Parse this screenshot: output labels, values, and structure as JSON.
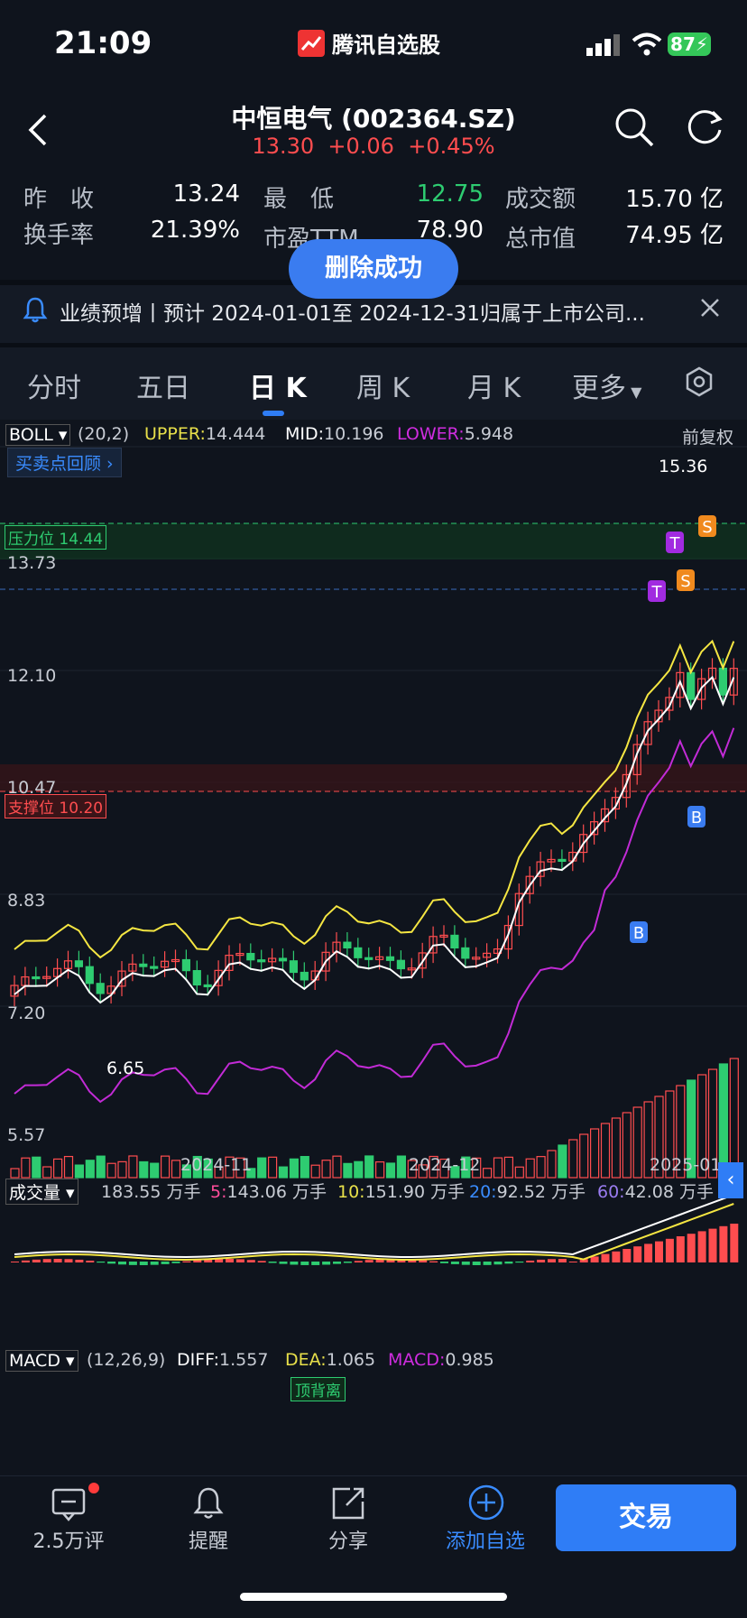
{
  "status_bar": {
    "time": "21:09",
    "app_name": "腾讯自选股",
    "battery": "87"
  },
  "header": {
    "title": "中恒电气 (002364.SZ)",
    "price": "13.30",
    "change": "+0.06",
    "change_pct": "+0.45%"
  },
  "quote": {
    "row1": [
      {
        "label": "昨　收",
        "value": "13.24",
        "color": "#ffffff"
      },
      {
        "label": "最　低",
        "value": "12.75",
        "color": "#2ecc71"
      },
      {
        "label": "成交额",
        "value": "15.70 亿",
        "color": "#ffffff"
      }
    ],
    "row2": [
      {
        "label": "换手率",
        "value": "21.39%",
        "color": "#ffffff"
      },
      {
        "label": "市盈TTM",
        "value": "78.90",
        "color": "#ffffff"
      },
      {
        "label": "总市值",
        "value": "74.95 亿",
        "color": "#ffffff"
      }
    ]
  },
  "toast": "删除成功",
  "notice": {
    "text": "业绩预增丨预计 2024-01-01至 2024-12-31归属于上市公司..."
  },
  "tabs": [
    "分时",
    "五日",
    "日 K",
    "周 K",
    "月 K",
    "更多"
  ],
  "active_tab": "日 K",
  "boll": {
    "name": "BOLL",
    "params": "(20,2)",
    "upper_label": "UPPER:",
    "upper": "14.444",
    "mid_label": "MID:",
    "mid": "10.196",
    "lower_label": "LOWER:",
    "lower": "5.948",
    "adjust": "前复权"
  },
  "review_button": "买卖点回顾",
  "levels": {
    "pressure": "压力位 14.44",
    "support": "支撑位 10.20"
  },
  "y_ticks": [
    "13.73",
    "12.10",
    "10.47",
    "8.83",
    "7.20",
    "5.57"
  ],
  "price_labels": {
    "high": "15.36",
    "low": "6.65"
  },
  "x_ticks": [
    "2024-11",
    "2024-12",
    "2025-01"
  ],
  "volume": {
    "name": "成交量",
    "value": "183.55 万手",
    "ma5_label": "5:",
    "ma5": "143.06 万手",
    "ma10_label": "10:",
    "ma10": "151.90 万手",
    "ma20_label": "20:",
    "ma20": "92.52 万手",
    "ma60_label": "60:",
    "ma60": "42.08 万手"
  },
  "macd": {
    "name": "MACD",
    "params": "(12,26,9)",
    "diff_label": "DIFF:",
    "diff": "1.557",
    "dea_label": "DEA:",
    "dea": "1.065",
    "macd_label": "MACD:",
    "macd": "0.985",
    "tag": "顶背离"
  },
  "markers": [
    "T",
    "T",
    "S",
    "S",
    "B",
    "B"
  ],
  "bottom_bar": {
    "comments": "2.5万评",
    "remind": "提醒",
    "share": "分享",
    "add": "添加自选",
    "trade": "交易"
  },
  "colors": {
    "up": "#ff4d4f",
    "down": "#2ecc71",
    "accent": "#2f7df6",
    "boll_upper": "#b0c",
    "boll_mid": "#f5e642",
    "boll_lower": "#ffffff"
  }
}
